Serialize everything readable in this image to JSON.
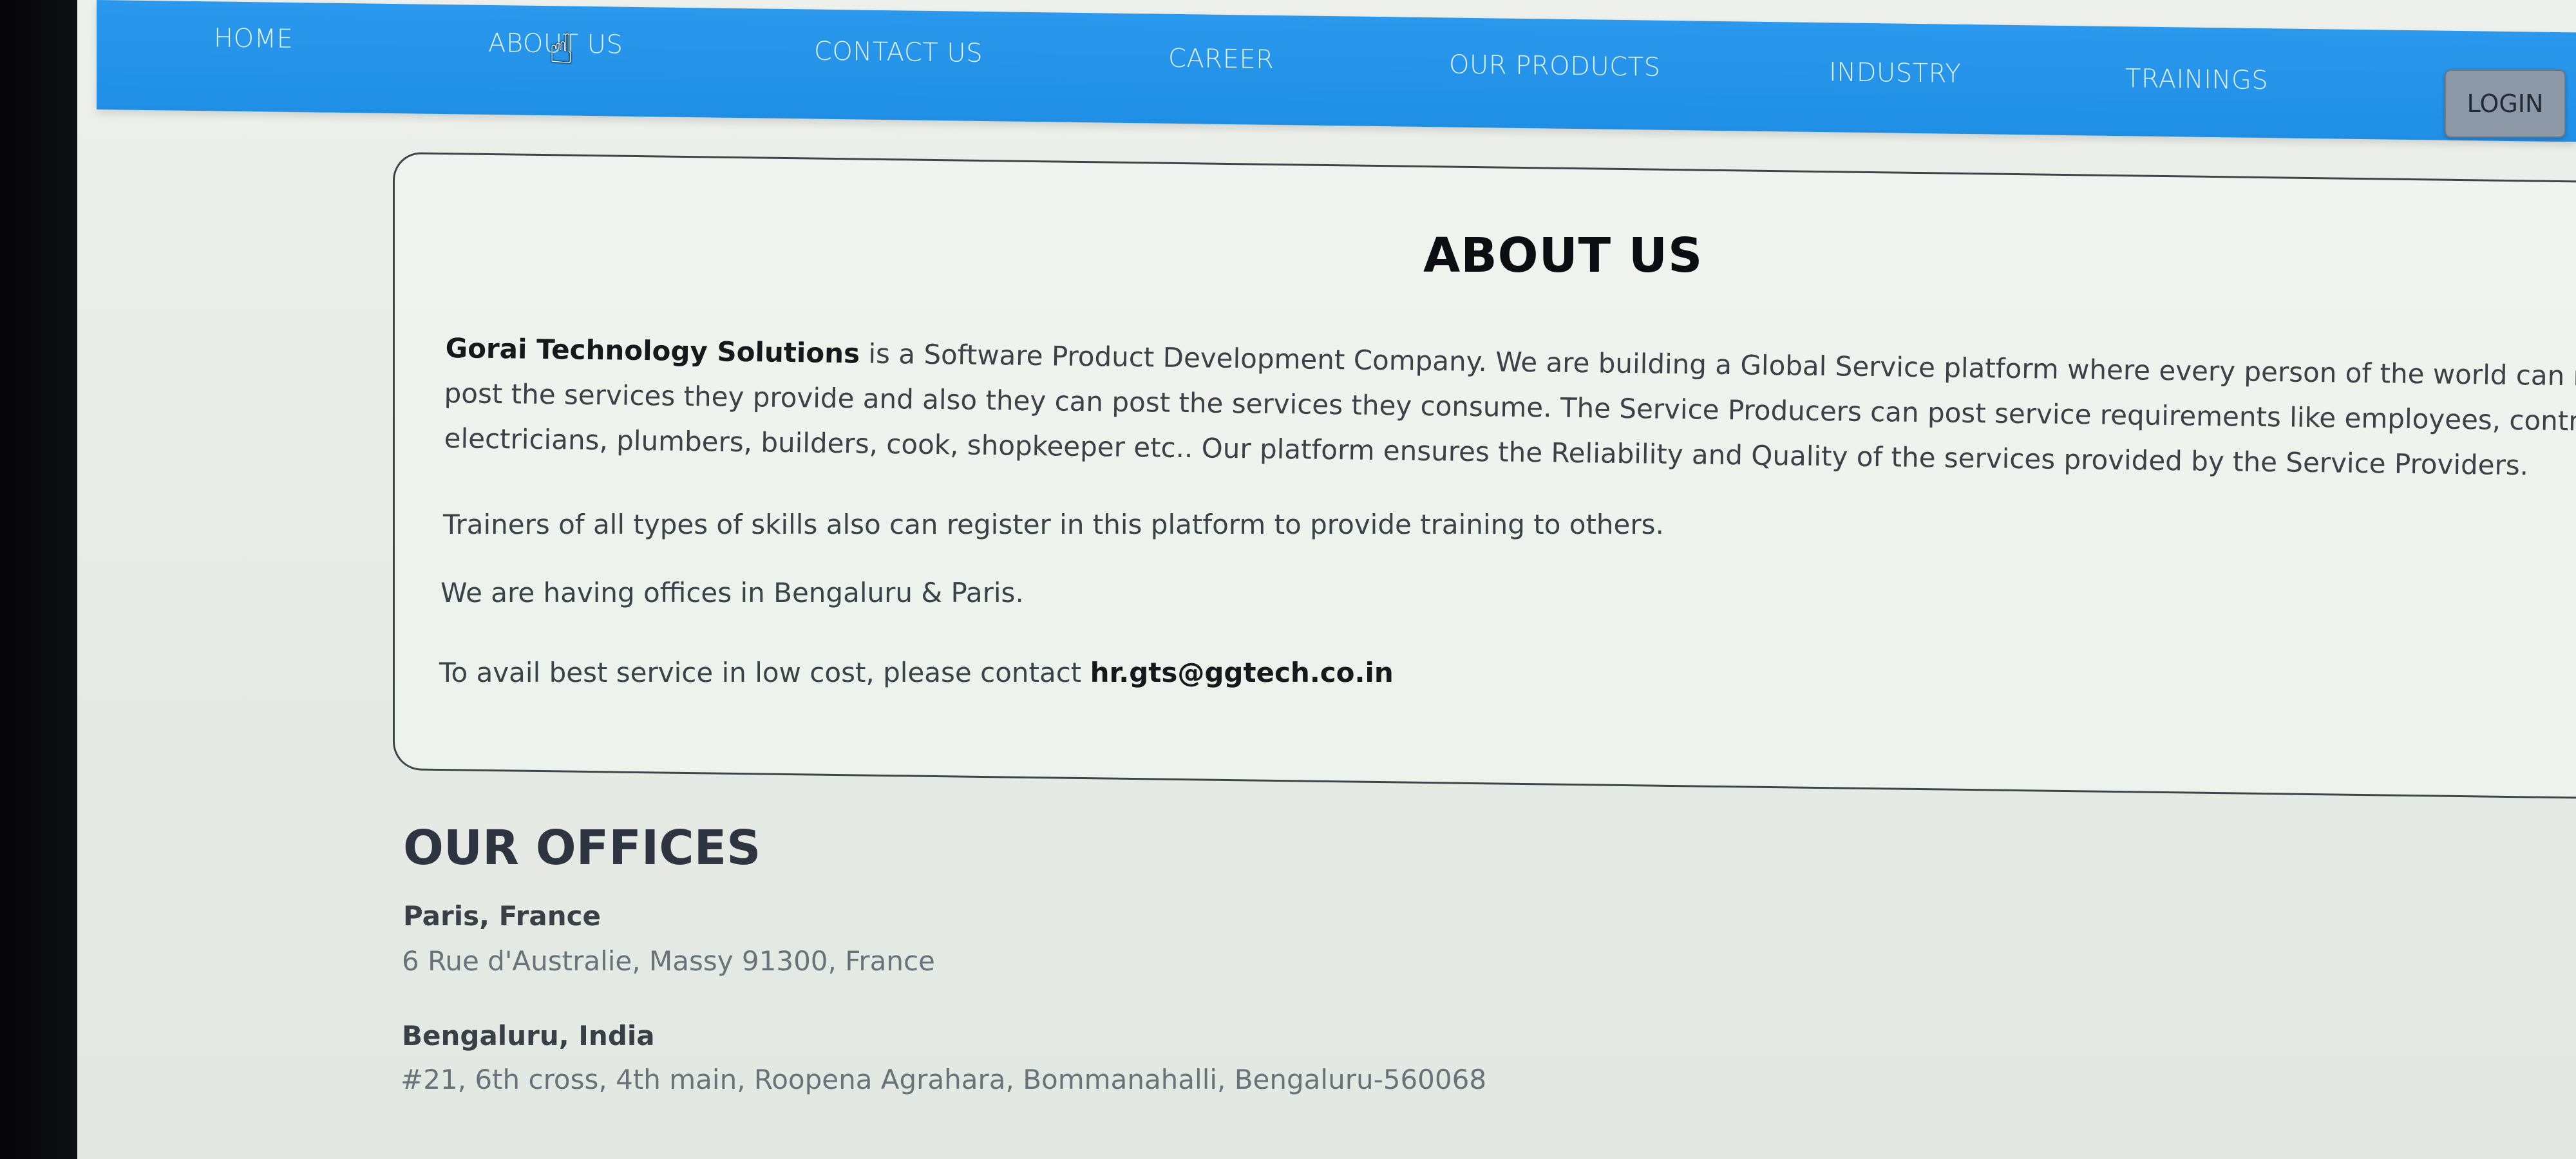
{
  "nav": {
    "items": [
      {
        "label": "HOME"
      },
      {
        "label": "ABOUT US"
      },
      {
        "label": "CONTACT US"
      },
      {
        "label": "CAREER"
      },
      {
        "label": "OUR PRODUCTS"
      },
      {
        "label": "INDUSTRY"
      },
      {
        "label": "TRAININGS"
      }
    ],
    "login_label": "LOGIN"
  },
  "about": {
    "title": "ABOUT US",
    "company": "Gorai Technology Solutions",
    "line1_rest": " is a Software Product Development Company. We are building a Global Service platform where every person of the world can register to",
    "line2": "post the services they provide and also they can post the services they consume. The Service Producers can post service requirements like employees, contractors,",
    "line3": "electricians, plumbers, builders, cook, shopkeeper etc.. Our platform ensures the Reliability and Quality of the services provided by the Service Providers.",
    "trainers": "Trainers of all types of skills also can register in this platform to provide training to others.",
    "offices_note": "We are having offices in Bengaluru & Paris.",
    "contact_prefix": "To avail best service in low cost, please contact ",
    "contact_email": "hr.gts@ggtech.co.in"
  },
  "offices": {
    "title": "OUR OFFICES",
    "list": [
      {
        "name": "Paris, France",
        "address": "6 Rue d'Australie, Massy 91300, France"
      },
      {
        "name": "Bengaluru, India",
        "address": "#21, 6th cross, 4th main, Roopena Agrahara, Bommanahalli, Bengaluru-560068"
      }
    ]
  }
}
